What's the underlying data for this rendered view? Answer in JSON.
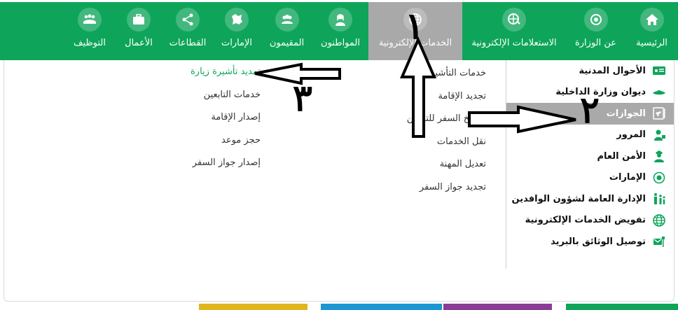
{
  "nav": {
    "items": [
      {
        "label": "الرئيسية",
        "icon": "home-icon"
      },
      {
        "label": "عن الوزارة",
        "icon": "ministry-emblem-icon"
      },
      {
        "label": "الاستعلامات الإلكترونية",
        "icon": "globe-search-icon"
      },
      {
        "label": "الخدمات الإلكترونية",
        "icon": "globe-icon"
      },
      {
        "label": "المواطنون",
        "icon": "citizen-icon"
      },
      {
        "label": "المقيمون",
        "icon": "residents-icon"
      },
      {
        "label": "الإمارات",
        "icon": "map-icon"
      },
      {
        "label": "القطاعات",
        "icon": "network-icon"
      },
      {
        "label": "الأعمال",
        "icon": "briefcase-icon"
      },
      {
        "label": "التوظيف",
        "icon": "team-icon"
      }
    ]
  },
  "sidebar": {
    "items": [
      {
        "label": "الأحوال المدنية",
        "icon": "id-card-icon"
      },
      {
        "label": "ديوان وزارة الداخلية",
        "icon": "hat-icon"
      },
      {
        "label": "الجوازات",
        "icon": "passport-icon"
      },
      {
        "label": "المرور",
        "icon": "traffic-icon"
      },
      {
        "label": "الأمن العام",
        "icon": "officer-icon"
      },
      {
        "label": "الإمارات",
        "icon": "emblem-icon"
      },
      {
        "label": "الإدارة العامة لشؤون الوافدين",
        "icon": "family-icon"
      },
      {
        "label": "تفويض الخدمات الإلكترونية",
        "icon": "globe-icon"
      },
      {
        "label": "توصيل الوثائق بالبريد",
        "icon": "mailbox-icon"
      }
    ]
  },
  "services_mid": [
    "خدمات التأشيرات",
    "تجديد الإقامة",
    "تواريخ السفر للتابعين",
    "نقل الخدمات",
    "تعديل المهنة",
    "تجديد جواز السفر"
  ],
  "services_left": [
    "تمديد تأشيرة زيارة",
    "خدمات التابعين",
    "إصدار الإقامة",
    "حجز موعد",
    "إصدار جواز السفر"
  ],
  "annotations": {
    "n1": "١",
    "n2": "٢",
    "n3": "٣"
  },
  "colors": {
    "brand_green": "#0ea55a",
    "active_gray": "#a9a9a9",
    "strip_yellow": "#e0b51e",
    "strip_blue": "#1a96d2",
    "strip_purple": "#8a3d96",
    "strip_green": "#0ea55a"
  }
}
